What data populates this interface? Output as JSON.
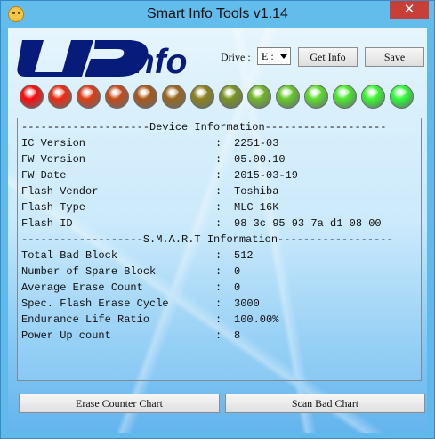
{
  "window": {
    "title": "Smart Info Tools v1.14",
    "close_symbol": "✕"
  },
  "drive": {
    "label": "Drive :",
    "value": "E :"
  },
  "buttons": {
    "get_info": "Get Info",
    "save": "Save",
    "erase_counter_chart": "Erase Counter Chart",
    "scan_bad_chart": "Scan Bad Chart"
  },
  "indicator_colors": [
    "#ff0a0a",
    "#f02a0f",
    "#df3b14",
    "#c64a18",
    "#aa5619",
    "#9b661b",
    "#8c821d",
    "#7a931d",
    "#72b62a",
    "#67c92a",
    "#5ede30",
    "#4dea2f",
    "#3bf932",
    "#2ffd39"
  ],
  "device_info": {
    "device_header": "--------------------Device Information-------------------",
    "smart_header": "-------------------S.M.A.R.T Information------------------",
    "device_rows": [
      {
        "label": "IC Version",
        "value": "2251-03"
      },
      {
        "label": "FW Version",
        "value": "05.00.10"
      },
      {
        "label": "FW Date",
        "value": "2015-03-19"
      },
      {
        "label": "Flash Vendor",
        "value": "Toshiba"
      },
      {
        "label": "Flash Type",
        "value": "MLC 16K"
      },
      {
        "label": "Flash ID",
        "value": "98 3c 95 93 7a d1 08 00"
      }
    ],
    "smart_rows": [
      {
        "label": "Total Bad Block",
        "value": "512"
      },
      {
        "label": "Number of Spare Block",
        "value": "0"
      },
      {
        "label": "Average Erase Count",
        "value": "0"
      },
      {
        "label": "Spec. Flash Erase Cycle",
        "value": "3000"
      },
      {
        "label": "Endurance Life Ratio",
        "value": "100.00%"
      },
      {
        "label": "Power Up count",
        "value": "8"
      }
    ],
    "separator": ":"
  },
  "logo": {
    "text": "info",
    "icon": "ud-logo"
  }
}
